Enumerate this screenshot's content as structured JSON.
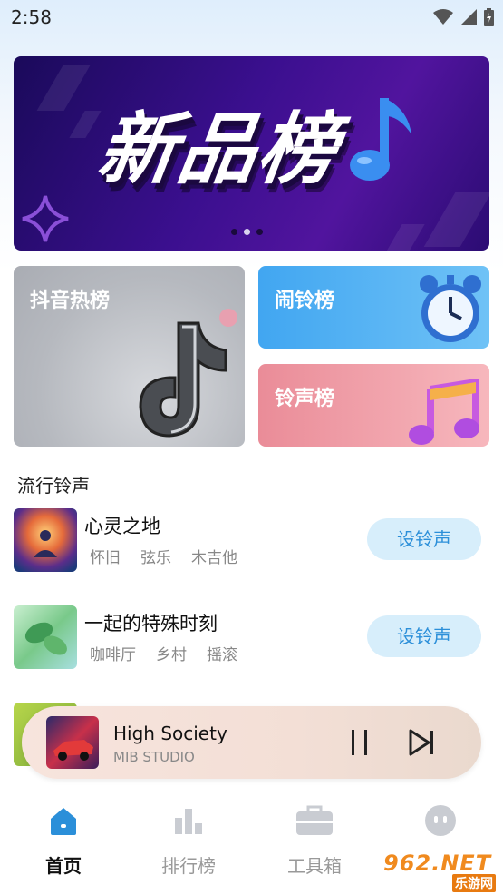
{
  "status_bar": {
    "time": "2:58"
  },
  "banner": {
    "title": "新品榜",
    "slide_count": 3,
    "active_slide": 2
  },
  "cards": {
    "douyin": {
      "label": "抖音热榜"
    },
    "alarm": {
      "label": "闹铃榜"
    },
    "ringtone": {
      "label": "铃声榜"
    }
  },
  "section": {
    "title": "流行铃声"
  },
  "songs": [
    {
      "name": "心灵之地",
      "tags": [
        "怀旧",
        "弦乐",
        "木吉他"
      ],
      "button": "设铃声"
    },
    {
      "name": "一起的特殊时刻",
      "tags": [
        "咖啡厅",
        "乡村",
        "摇滚"
      ],
      "button": "设铃声"
    }
  ],
  "player": {
    "title": "High Society",
    "artist": "MIB STUDIO"
  },
  "tabs": [
    {
      "label": "首页",
      "icon": "home-icon",
      "active": true
    },
    {
      "label": "排行榜",
      "icon": "bar-chart-icon",
      "active": false
    },
    {
      "label": "工具箱",
      "icon": "toolbox-icon",
      "active": false
    },
    {
      "label": "",
      "icon": "profile-icon",
      "active": false
    }
  ],
  "watermark": {
    "text": "962.NET",
    "subtext": "乐游网"
  },
  "colors": {
    "accent": "#2b8fd9",
    "button_bg": "#d7eefb",
    "tab_active": "#2b8fd9"
  }
}
